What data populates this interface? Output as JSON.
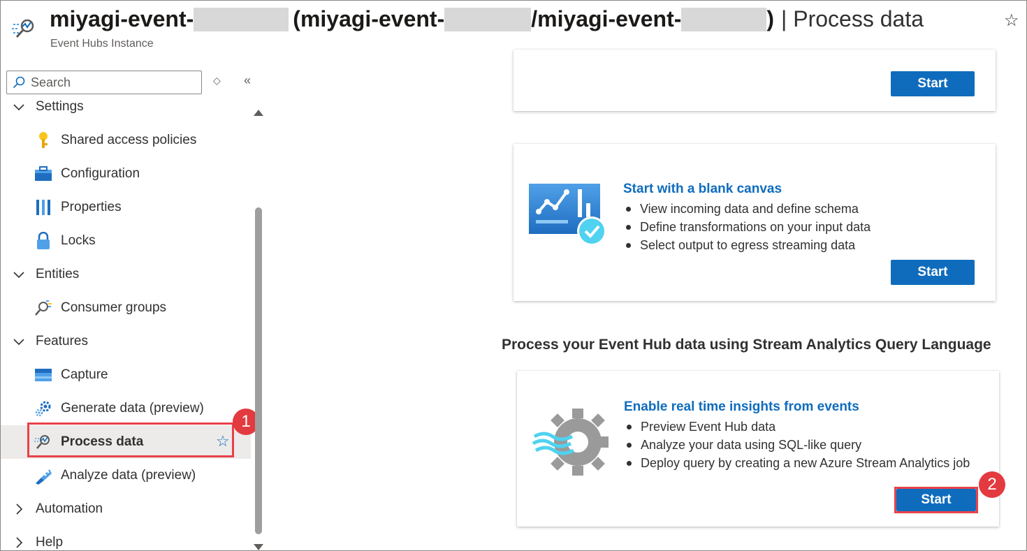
{
  "header": {
    "title_part1": "miyagi-event-",
    "title_part2": "(miyagi-event-",
    "title_part3": "/miyagi-event-",
    "title_part4": ")",
    "title_suffix": "| Process data",
    "subtitle": "Event Hubs Instance",
    "favorite_icon": "star-outline-icon"
  },
  "sidebar": {
    "search_placeholder": "Search",
    "groups": {
      "settings": "Settings",
      "entities": "Entities",
      "features": "Features",
      "automation": "Automation",
      "help": "Help"
    },
    "items": {
      "shared_access": "Shared access policies",
      "configuration": "Configuration",
      "properties": "Properties",
      "locks": "Locks",
      "consumer_groups": "Consumer groups",
      "capture": "Capture",
      "generate_data": "Generate data (preview)",
      "process_data": "Process data",
      "analyze_data": "Analyze data (preview)"
    }
  },
  "badges": {
    "first": "1",
    "second": "2"
  },
  "main": {
    "top_card": {
      "button": "Start"
    },
    "blank_canvas_card": {
      "title": "Start with a blank canvas",
      "bullets": [
        "View incoming data and define schema",
        "Define transformations on your input data",
        "Select output to egress streaming data"
      ],
      "button": "Start"
    },
    "section_heading": "Process your Event Hub data using Stream Analytics Query Language",
    "insights_card": {
      "title": "Enable real time insights from events",
      "bullets": [
        "Preview Event Hub data",
        "Analyze your data using SQL-like query",
        "Deploy query by creating a new Azure Stream Analytics job"
      ],
      "button": "Start"
    }
  },
  "colors": {
    "accent": "#0f6cbd",
    "highlight": "#e8414a",
    "badge": "#e33a3f"
  }
}
